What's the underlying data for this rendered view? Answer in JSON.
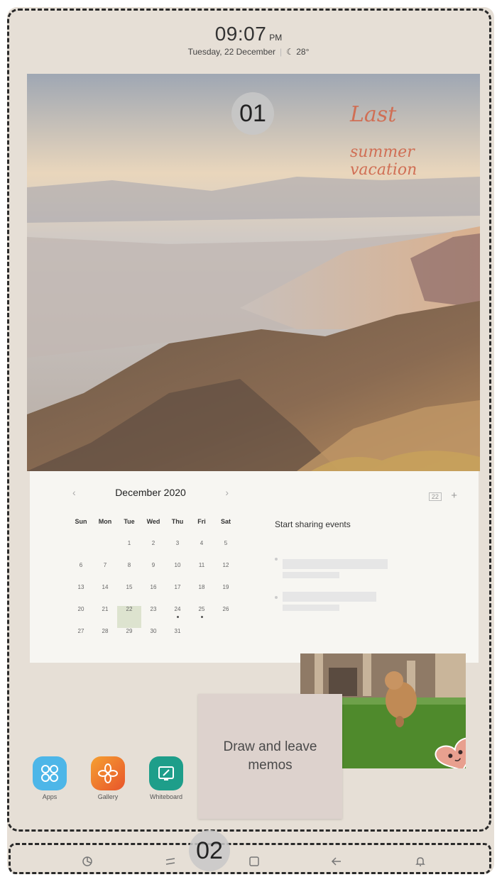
{
  "status": {
    "time": "09:07",
    "ampm": "PM",
    "date": "Tuesday, 22 December",
    "weather": "28°",
    "sep": "|"
  },
  "photo": {
    "text_line1": "Last",
    "text_line2": "summer vacation"
  },
  "badges": {
    "one": "01",
    "two": "02"
  },
  "calendar": {
    "month": "December 2020",
    "prev": "‹",
    "next": "›",
    "weekdays": [
      "Sun",
      "Mon",
      "Tue",
      "Wed",
      "Thu",
      "Fri",
      "Sat"
    ],
    "weeks": [
      [
        "",
        "",
        "1",
        "2",
        "3",
        "4",
        "5"
      ],
      [
        "6",
        "7",
        "8",
        "9",
        "10",
        "11",
        "12"
      ],
      [
        "13",
        "14",
        "15",
        "16",
        "17",
        "18",
        "19"
      ],
      [
        "20",
        "21",
        "22",
        "23",
        "24",
        "25",
        "26"
      ],
      [
        "27",
        "28",
        "29",
        "30",
        "31",
        "",
        ""
      ]
    ],
    "today": "22",
    "event_days": [
      "24",
      "25"
    ],
    "share_title": "Start sharing events",
    "add": "+",
    "cal_icon": "22"
  },
  "memo": {
    "text": "Draw and leave memos"
  },
  "apps": [
    {
      "label": "Apps",
      "color": "#4db6e8",
      "icon": "apps-icon"
    },
    {
      "label": "Gallery",
      "color": "#f07a2a",
      "icon": "gallery-icon"
    },
    {
      "label": "Whiteboard",
      "color": "#1e9e8a",
      "icon": "whiteboard-icon"
    }
  ],
  "nav": {
    "icons": [
      "bixby-icon",
      "recents-icon",
      "home-icon",
      "back-icon",
      "notification-icon"
    ]
  }
}
